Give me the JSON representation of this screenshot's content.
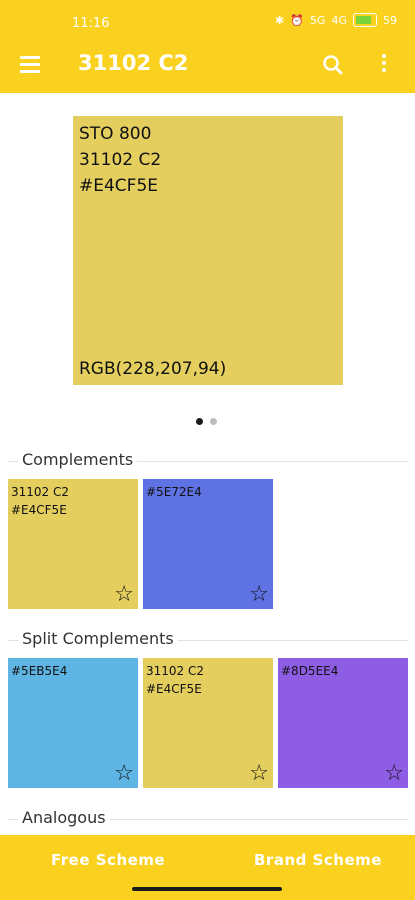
{
  "status_bar": {
    "time": "11:16",
    "net1": "5G",
    "net2": "4G",
    "battery": "59"
  },
  "toolbar": {
    "title": "31102 C2"
  },
  "hero": {
    "line1": "STO 800",
    "line2": "31102 C2",
    "line3": "#E4CF5E",
    "rgb": "RGB(228,207,94)",
    "color": "#E4CF5E"
  },
  "pager": {
    "pages": 2,
    "current": 1
  },
  "sections": {
    "complements": {
      "title": "Complements",
      "swatches": [
        {
          "name": "31102 C2",
          "hex": "#E4CF5E",
          "color": "#E4CF5E"
        },
        {
          "hex": "#5E72E4",
          "color": "#5E72E4"
        }
      ]
    },
    "split": {
      "title": "Split Complements",
      "swatches": [
        {
          "hex": "#5EB5E4",
          "color": "#5EB5E4"
        },
        {
          "name": "31102 C2",
          "hex": "#E4CF5E",
          "color": "#E4CF5E"
        },
        {
          "hex": "#8D5EE4",
          "color": "#8D5EE4"
        }
      ]
    },
    "analogous": {
      "title": "Analogous"
    }
  },
  "bottom_nav": {
    "free": "Free Scheme",
    "brand": "Brand Scheme"
  },
  "icons": {
    "menu": "menu-icon",
    "search": "search-icon",
    "more": "more-vert-icon",
    "favorite": "star-outline-icon"
  },
  "colors": {
    "accent": "#FAD11E"
  }
}
